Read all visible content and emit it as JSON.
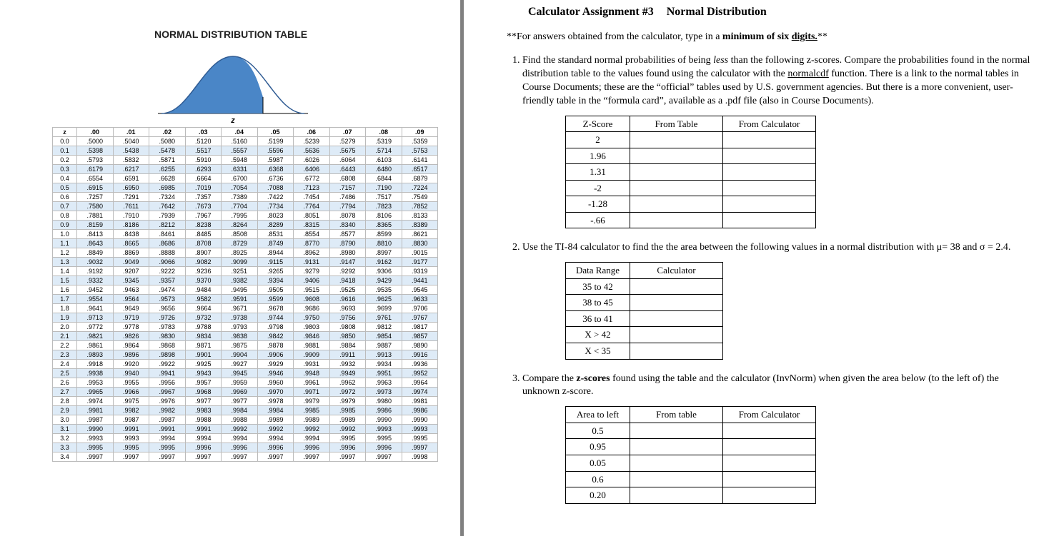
{
  "left": {
    "title": "NORMAL DISTRIBUTION TABLE",
    "axis_label": "z",
    "col_headers": [
      "z",
      ".00",
      ".01",
      ".02",
      ".03",
      ".04",
      ".05",
      ".06",
      ".07",
      ".08",
      ".09"
    ],
    "rows": [
      [
        "0.0",
        ".5000",
        ".5040",
        ".5080",
        ".5120",
        ".5160",
        ".5199",
        ".5239",
        ".5279",
        ".5319",
        ".5359"
      ],
      [
        "0.1",
        ".5398",
        ".5438",
        ".5478",
        ".5517",
        ".5557",
        ".5596",
        ".5636",
        ".5675",
        ".5714",
        ".5753"
      ],
      [
        "0.2",
        ".5793",
        ".5832",
        ".5871",
        ".5910",
        ".5948",
        ".5987",
        ".6026",
        ".6064",
        ".6103",
        ".6141"
      ],
      [
        "0.3",
        ".6179",
        ".6217",
        ".6255",
        ".6293",
        ".6331",
        ".6368",
        ".6406",
        ".6443",
        ".6480",
        ".6517"
      ],
      [
        "0.4",
        ".6554",
        ".6591",
        ".6628",
        ".6664",
        ".6700",
        ".6736",
        ".6772",
        ".6808",
        ".6844",
        ".6879"
      ],
      [
        "0.5",
        ".6915",
        ".6950",
        ".6985",
        ".7019",
        ".7054",
        ".7088",
        ".7123",
        ".7157",
        ".7190",
        ".7224"
      ],
      [
        "0.6",
        ".7257",
        ".7291",
        ".7324",
        ".7357",
        ".7389",
        ".7422",
        ".7454",
        ".7486",
        ".7517",
        ".7549"
      ],
      [
        "0.7",
        ".7580",
        ".7611",
        ".7642",
        ".7673",
        ".7704",
        ".7734",
        ".7764",
        ".7794",
        ".7823",
        ".7852"
      ],
      [
        "0.8",
        ".7881",
        ".7910",
        ".7939",
        ".7967",
        ".7995",
        ".8023",
        ".8051",
        ".8078",
        ".8106",
        ".8133"
      ],
      [
        "0.9",
        ".8159",
        ".8186",
        ".8212",
        ".8238",
        ".8264",
        ".8289",
        ".8315",
        ".8340",
        ".8365",
        ".8389"
      ],
      [
        "1.0",
        ".8413",
        ".8438",
        ".8461",
        ".8485",
        ".8508",
        ".8531",
        ".8554",
        ".8577",
        ".8599",
        ".8621"
      ],
      [
        "1.1",
        ".8643",
        ".8665",
        ".8686",
        ".8708",
        ".8729",
        ".8749",
        ".8770",
        ".8790",
        ".8810",
        ".8830"
      ],
      [
        "1.2",
        ".8849",
        ".8869",
        ".8888",
        ".8907",
        ".8925",
        ".8944",
        ".8962",
        ".8980",
        ".8997",
        ".9015"
      ],
      [
        "1.3",
        ".9032",
        ".9049",
        ".9066",
        ".9082",
        ".9099",
        ".9115",
        ".9131",
        ".9147",
        ".9162",
        ".9177"
      ],
      [
        "1.4",
        ".9192",
        ".9207",
        ".9222",
        ".9236",
        ".9251",
        ".9265",
        ".9279",
        ".9292",
        ".9306",
        ".9319"
      ],
      [
        "1.5",
        ".9332",
        ".9345",
        ".9357",
        ".9370",
        ".9382",
        ".9394",
        ".9406",
        ".9418",
        ".9429",
        ".9441"
      ],
      [
        "1.6",
        ".9452",
        ".9463",
        ".9474",
        ".9484",
        ".9495",
        ".9505",
        ".9515",
        ".9525",
        ".9535",
        ".9545"
      ],
      [
        "1.7",
        ".9554",
        ".9564",
        ".9573",
        ".9582",
        ".9591",
        ".9599",
        ".9608",
        ".9616",
        ".9625",
        ".9633"
      ],
      [
        "1.8",
        ".9641",
        ".9649",
        ".9656",
        ".9664",
        ".9671",
        ".9678",
        ".9686",
        ".9693",
        ".9699",
        ".9706"
      ],
      [
        "1.9",
        ".9713",
        ".9719",
        ".9726",
        ".9732",
        ".9738",
        ".9744",
        ".9750",
        ".9756",
        ".9761",
        ".9767"
      ],
      [
        "2.0",
        ".9772",
        ".9778",
        ".9783",
        ".9788",
        ".9793",
        ".9798",
        ".9803",
        ".9808",
        ".9812",
        ".9817"
      ],
      [
        "2.1",
        ".9821",
        ".9826",
        ".9830",
        ".9834",
        ".9838",
        ".9842",
        ".9846",
        ".9850",
        ".9854",
        ".9857"
      ],
      [
        "2.2",
        ".9861",
        ".9864",
        ".9868",
        ".9871",
        ".9875",
        ".9878",
        ".9881",
        ".9884",
        ".9887",
        ".9890"
      ],
      [
        "2.3",
        ".9893",
        ".9896",
        ".9898",
        ".9901",
        ".9904",
        ".9906",
        ".9909",
        ".9911",
        ".9913",
        ".9916"
      ],
      [
        "2.4",
        ".9918",
        ".9920",
        ".9922",
        ".9925",
        ".9927",
        ".9929",
        ".9931",
        ".9932",
        ".9934",
        ".9936"
      ],
      [
        "2.5",
        ".9938",
        ".9940",
        ".9941",
        ".9943",
        ".9945",
        ".9946",
        ".9948",
        ".9949",
        ".9951",
        ".9952"
      ],
      [
        "2.6",
        ".9953",
        ".9955",
        ".9956",
        ".9957",
        ".9959",
        ".9960",
        ".9961",
        ".9962",
        ".9963",
        ".9964"
      ],
      [
        "2.7",
        ".9965",
        ".9966",
        ".9967",
        ".9968",
        ".9969",
        ".9970",
        ".9971",
        ".9972",
        ".9973",
        ".9974"
      ],
      [
        "2.8",
        ".9974",
        ".9975",
        ".9976",
        ".9977",
        ".9977",
        ".9978",
        ".9979",
        ".9979",
        ".9980",
        ".9981"
      ],
      [
        "2.9",
        ".9981",
        ".9982",
        ".9982",
        ".9983",
        ".9984",
        ".9984",
        ".9985",
        ".9985",
        ".9986",
        ".9986"
      ],
      [
        "3.0",
        ".9987",
        ".9987",
        ".9987",
        ".9988",
        ".9988",
        ".9989",
        ".9989",
        ".9989",
        ".9990",
        ".9990"
      ],
      [
        "3.1",
        ".9990",
        ".9991",
        ".9991",
        ".9991",
        ".9992",
        ".9992",
        ".9992",
        ".9992",
        ".9993",
        ".9993"
      ],
      [
        "3.2",
        ".9993",
        ".9993",
        ".9994",
        ".9994",
        ".9994",
        ".9994",
        ".9994",
        ".9995",
        ".9995",
        ".9995"
      ],
      [
        "3.3",
        ".9995",
        ".9995",
        ".9995",
        ".9996",
        ".9996",
        ".9996",
        ".9996",
        ".9996",
        ".9996",
        ".9997"
      ],
      [
        "3.4",
        ".9997",
        ".9997",
        ".9997",
        ".9997",
        ".9997",
        ".9997",
        ".9997",
        ".9997",
        ".9997",
        ".9998"
      ]
    ]
  },
  "right": {
    "title_a": "Calculator Assignment #3",
    "title_b": "Normal Distribution",
    "note_prefix": "**For answers obtained from the calculator, type in a ",
    "note_bold": "minimum of six ",
    "note_u": "digits.",
    "note_suffix": "**",
    "q1": {
      "text_a": "Find the standard normal probabilities of being ",
      "text_ital": "less",
      "text_b": " than the following z-scores. Compare the probabilities found in the normal distribution table to the values found using the calculator with the ",
      "text_u": "normalcdf",
      "text_c": " function.   There is a link to the normal tables in Course Documents; these are the “official” tables used by U.S. government agencies.  But there is a more convenient, user-friendly table in the “formula card”, available as a .pdf file (also in Course Documents).",
      "headers": [
        "Z-Score",
        "From Table",
        "From Calculator"
      ],
      "rows": [
        "2",
        "1.96",
        "1.31",
        "-2",
        "-1.28",
        "-.66"
      ]
    },
    "q2": {
      "text": "Use the TI-84 calculator to find the the area between the following values in a normal distribution with μ= 38 and σ = 2.4.",
      "headers": [
        "Data Range",
        "Calculator"
      ],
      "rows": [
        "35 to 42",
        "38 to 45",
        "36 to 41",
        "X > 42",
        "X < 35"
      ]
    },
    "q3": {
      "text_a": "Compare the ",
      "text_bold": "z-scores",
      "text_b": " found using the table and the calculator (InvNorm) when given the area below (to the left of) the unknown z-score.",
      "headers": [
        "Area to left",
        "From table",
        "From Calculator"
      ],
      "rows": [
        "0.5",
        "0.95",
        "0.05",
        "0.6",
        "0.20"
      ]
    }
  },
  "chart_data": {
    "type": "area",
    "title": "Standard Normal Curve",
    "xlabel": "z",
    "ylabel": "",
    "xlim": [
      -3.5,
      3.5
    ],
    "description": "Bell curve of standard normal distribution, area shaded blue to the left of a z value near 1, right tail unshaded."
  }
}
